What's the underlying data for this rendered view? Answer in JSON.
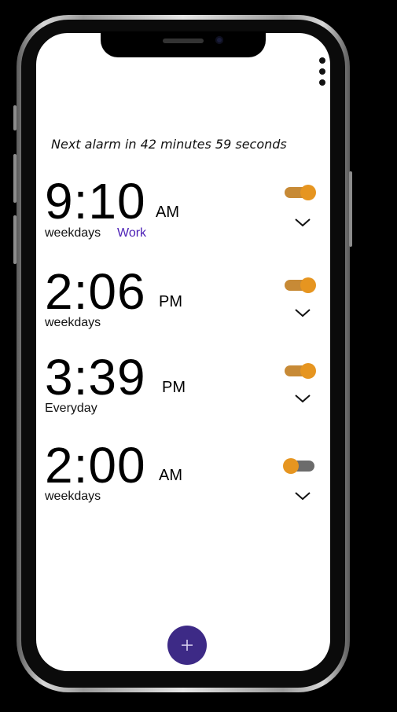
{
  "next_alarm_text": "Next alarm in 42 minutes 59 seconds",
  "alarms": [
    {
      "time": "9:10",
      "ampm": "AM",
      "repeat": "weekdays",
      "label": "Work",
      "enabled": true
    },
    {
      "time": "2:06",
      "ampm": "PM",
      "repeat": "weekdays",
      "label": "",
      "enabled": true
    },
    {
      "time": "3:39",
      "ampm": "PM",
      "repeat": "Everyday",
      "label": "",
      "enabled": true
    },
    {
      "time": "2:00",
      "ampm": "AM",
      "repeat": "weekdays",
      "label": "",
      "enabled": false
    }
  ],
  "icons": {
    "menu": "more-vertical-icon",
    "expand": "chevron-down-icon",
    "add": "plus-icon"
  },
  "colors": {
    "toggle_on_track": "#c78a36",
    "toggle_thumb": "#e69520",
    "toggle_off_track": "#6b6b6b",
    "label_color": "#4b1fb5",
    "fab_background": "#3d2a86"
  }
}
